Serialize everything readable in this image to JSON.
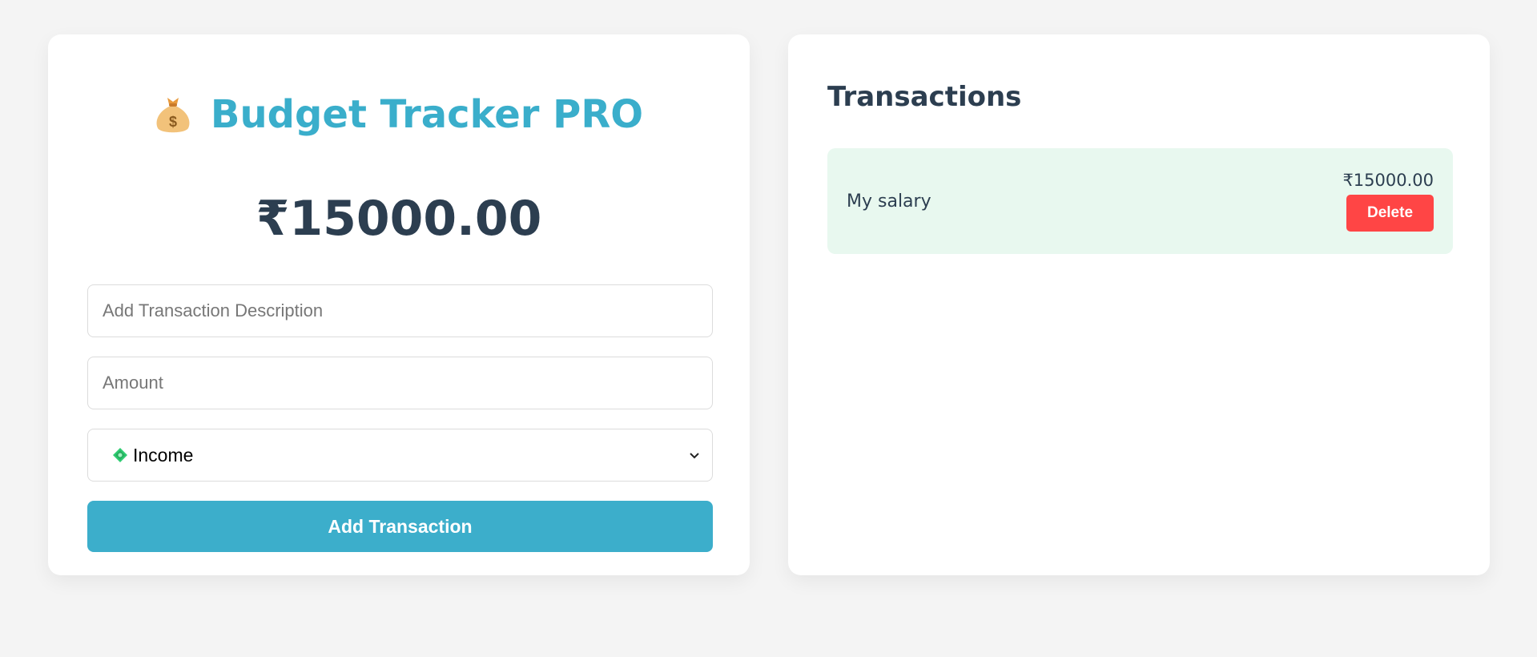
{
  "app": {
    "title": "Budget Tracker PRO",
    "title_icon": "money-bag-icon",
    "balance": "₹15000.00"
  },
  "form": {
    "description_placeholder": "Add Transaction Description",
    "description_value": "",
    "amount_placeholder": "Amount",
    "amount_value": "",
    "type_icon": "money-with-wings-icon",
    "type_selected": "Income",
    "add_button": "Add Transaction"
  },
  "transactions": {
    "heading": "Transactions",
    "items": [
      {
        "description": "My salary",
        "amount": "₹15000.00",
        "delete_label": "Delete",
        "type": "income"
      }
    ]
  },
  "colors": {
    "accent": "#3caecb",
    "text": "#2c3e50",
    "income_bg": "#e8f8ef",
    "delete": "#ff4545",
    "page_bg": "#f4f4f4"
  }
}
